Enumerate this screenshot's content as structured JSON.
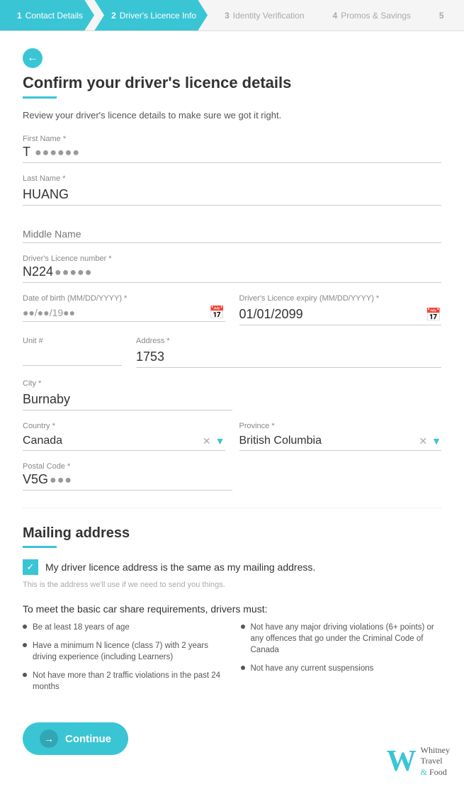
{
  "progress": {
    "steps": [
      {
        "id": 1,
        "label": "Contact Details",
        "active": false,
        "done": true
      },
      {
        "id": 2,
        "label": "Driver's Licence Info",
        "active": true,
        "done": false
      },
      {
        "id": 3,
        "label": "Identity Verification",
        "active": false,
        "done": false
      },
      {
        "id": 4,
        "label": "Promos & Savings",
        "active": false,
        "done": false
      },
      {
        "id": 5,
        "label": "5",
        "active": false,
        "done": false
      }
    ]
  },
  "page": {
    "title": "Confirm your driver's licence details",
    "subtitle": "Review your driver's licence details to make sure we got it right."
  },
  "form": {
    "first_name_label": "First Name *",
    "first_name_value": "T",
    "first_name_masked": "●●●●●●",
    "last_name_label": "Last Name *",
    "last_name_value": "HUANG",
    "middle_name_label": "Middle Name",
    "middle_name_placeholder": "Middle Name",
    "licence_number_label": "Driver's Licence number *",
    "licence_number_value": "N224",
    "licence_number_masked": "●●●●●",
    "dob_label": "Date of birth (MM/DD/YYYY) *",
    "dob_value": "●●/●●/19●●",
    "expiry_label": "Driver's Licence expiry (MM/DD/YYYY) *",
    "expiry_value": "01/01/2099",
    "unit_label": "Unit #",
    "unit_value": "",
    "address_label": "Address *",
    "address_value": "1753",
    "city_label": "City *",
    "city_value": "Burnaby",
    "country_label": "Country *",
    "country_value": "Canada",
    "province_label": "Province *",
    "province_value": "British Columbia",
    "postal_label": "Postal Code *",
    "postal_value": "V5G",
    "postal_masked": "●●●"
  },
  "mailing": {
    "heading": "Mailing address",
    "checkbox_label": "My driver licence address is the same as my mailing address.",
    "checkbox_checked": true,
    "note": "This is the address we'll use if we need to send you things."
  },
  "requirements": {
    "heading": "To meet the basic car share requirements, drivers must:",
    "left_items": [
      "Be at least 18 years of age",
      "Have a minimum N licence (class 7) with 2 years driving experience (including Learners)",
      "Not have more than 2 traffic violations in the past 24 months"
    ],
    "right_items": [
      "Not have any major driving violations (6+ points) or any offences that go under the Criminal Code of Canada",
      "Not have any current suspensions"
    ]
  },
  "footer": {
    "continue_label": "Continue",
    "logo_w": "W",
    "logo_line1": "Whitney",
    "logo_line2": "Travel",
    "logo_line3": "& Food"
  }
}
